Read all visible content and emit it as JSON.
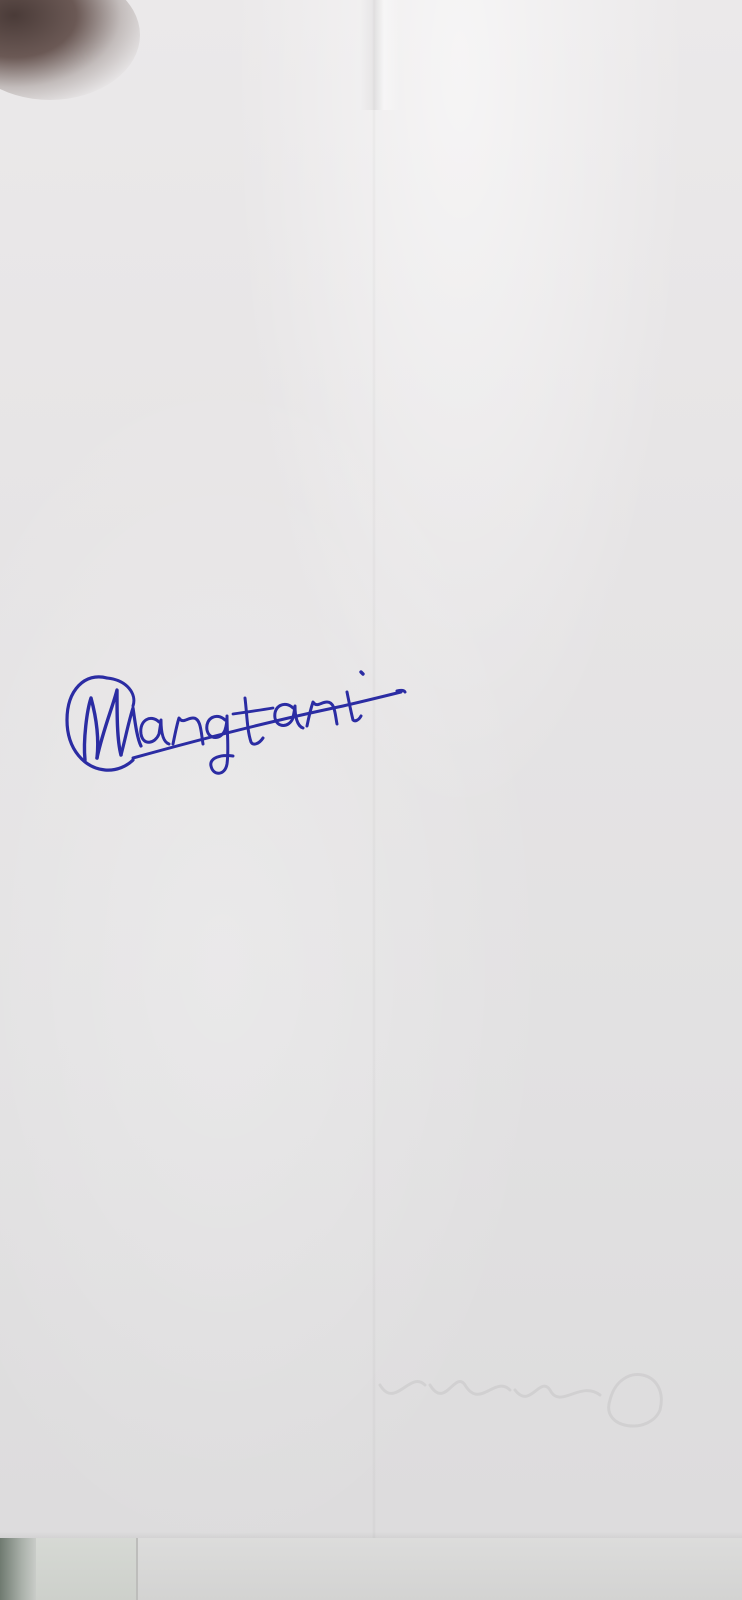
{
  "image": {
    "kind": "photo of a blank sheet of paper with a handwritten signature",
    "paper_color": "#e6e4e5",
    "ink_color": "#2a2aa0"
  },
  "signature": {
    "text": "Mangtani",
    "style": "handwritten cursive in blue ink, first letter encircled, underlined with a long stroke"
  }
}
